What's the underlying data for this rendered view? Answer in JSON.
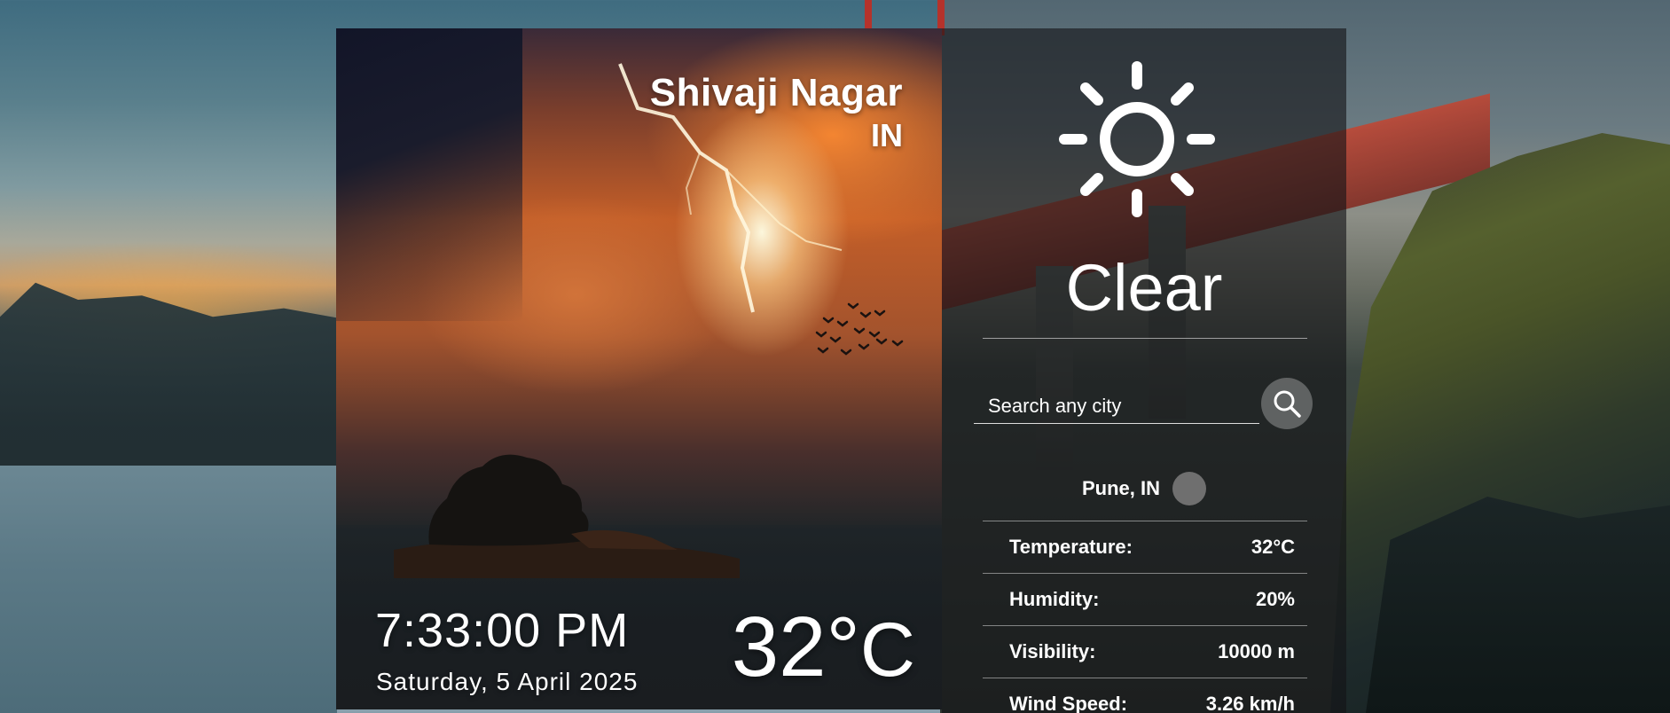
{
  "location": {
    "city": "Shivaji Nagar",
    "country": "IN"
  },
  "time": {
    "clock": "7:33:00 PM",
    "date": "Saturday, 5 April 2025"
  },
  "current": {
    "temperature_value": "32°",
    "temperature_unit": "C",
    "condition": "Clear",
    "condition_icon": "sun-icon"
  },
  "search": {
    "placeholder": "Search any city",
    "value": "",
    "button_icon": "search-icon"
  },
  "result_location": "Pune, IN",
  "stats": [
    {
      "label": "Temperature:",
      "value": "32°C"
    },
    {
      "label": "Humidity:",
      "value": "20%"
    },
    {
      "label": "Visibility:",
      "value": "10000 m"
    },
    {
      "label": "Wind Speed:",
      "value": "3.26 km/h"
    }
  ],
  "colors": {
    "panel_overlay": "#141416",
    "text": "#ffffff",
    "search_button": "#ffffff47"
  }
}
